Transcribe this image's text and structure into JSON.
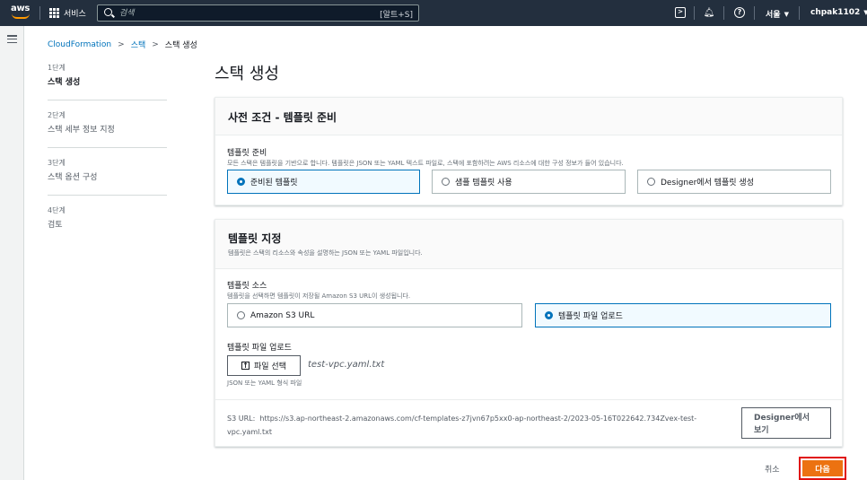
{
  "topnav": {
    "logo_text": "aws",
    "services_label": "서비스",
    "search_placeholder": "검색",
    "search_shortcut": "[알트+S]",
    "region": "서울",
    "user": "chpak1102"
  },
  "breadcrumb": {
    "items": [
      "CloudFormation",
      "스택",
      "스택 생성"
    ]
  },
  "steps": [
    {
      "num": "1단계",
      "label": "스택 생성"
    },
    {
      "num": "2단계",
      "label": "스택 세부 정보 지정"
    },
    {
      "num": "3단계",
      "label": "스택 옵션 구성"
    },
    {
      "num": "4단계",
      "label": "검토"
    }
  ],
  "page_title": "스택 생성",
  "prereq": {
    "title": "사전 조건 - 템플릿 준비",
    "field_label": "템플릿 준비",
    "field_desc": "모든 스택은 템플릿을 기반으로 합니다. 템플릿은 JSON 또는 YAML 텍스트 파일로, 스택에 포함하려는 AWS 리소스에 대한 구성 정보가 들어 있습니다.",
    "options": [
      "준비된 템플릿",
      "샘플 템플릿 사용",
      "Designer에서 템플릿 생성"
    ],
    "selected": 0
  },
  "template": {
    "title": "템플릿 지정",
    "desc": "템플릿은 스택의 리소스와 속성을 설명하는 JSON 또는 YAML 파일입니다.",
    "source_label": "템플릿 소스",
    "source_desc": "템플릿을 선택하면 템플릿이 저장될 Amazon S3 URL이 생성됩니다.",
    "source_options": [
      "Amazon S3 URL",
      "템플릿 파일 업로드"
    ],
    "source_selected": 1,
    "upload_label": "템플릿 파일 업로드",
    "file_button": "파일 선택",
    "file_name": "test-vpc.yaml.txt",
    "file_hint": "JSON 또는 YAML 형식 파일",
    "s3_url_label": "S3 URL:",
    "s3_url_value": "https://s3.ap-northeast-2.amazonaws.com/cf-templates-z7jvn67p5xx0-ap-northeast-2/2023-05-16T022642.734Zvex-test-vpc.yaml.txt",
    "designer_button": "Designer에서 보기"
  },
  "footer": {
    "cancel_label": "취소",
    "next_label": "다음"
  },
  "colors": {
    "nav_bg": "#232f3e",
    "accent": "#ec7211",
    "link": "#0073bb",
    "highlight_border": "#e01010"
  }
}
